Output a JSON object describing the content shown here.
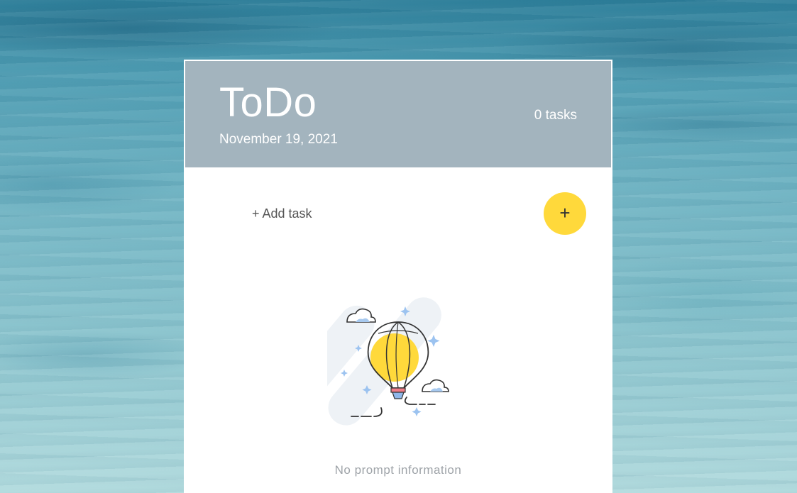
{
  "header": {
    "title": "ToDo",
    "date": "November 19, 2021",
    "task_count": "0 tasks",
    "background_color": "#a3b4be"
  },
  "add_row": {
    "add_task_label": "+ Add task",
    "add_button_label": "+",
    "add_button_color": "#ffd93b"
  },
  "empty_state": {
    "illustration_icon": "hot-air-balloon-icon",
    "message": "No prompt information"
  }
}
